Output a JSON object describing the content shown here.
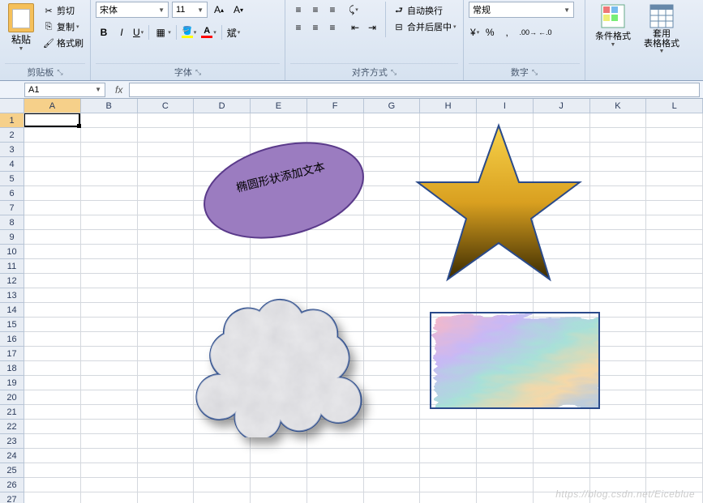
{
  "ribbon": {
    "clipboard": {
      "paste": "粘贴",
      "cut": "剪切",
      "copy": "复制",
      "format_painter": "格式刷",
      "group_label": "剪贴板"
    },
    "font": {
      "name": "宋体",
      "size": "11",
      "bold": "B",
      "italic": "I",
      "underline": "U",
      "wen": "斌",
      "group_label": "字体"
    },
    "align": {
      "wrap": "自动换行",
      "merge": "合并后居中",
      "group_label": "对齐方式"
    },
    "number": {
      "format": "常规",
      "group_label": "数字"
    },
    "styles": {
      "cond": "条件格式",
      "table": "套用\n表格格式"
    }
  },
  "namebox": {
    "value": "A1"
  },
  "formula": {
    "value": ""
  },
  "columns": [
    "A",
    "B",
    "C",
    "D",
    "E",
    "F",
    "G",
    "H",
    "I",
    "J",
    "K",
    "L"
  ],
  "row_count": 27,
  "active_cell": {
    "col": 0,
    "row": 0
  },
  "shapes": {
    "ellipse_text": "椭圆形状添加文本"
  },
  "watermark": "https://blog.csdn.net/Eiceblue"
}
